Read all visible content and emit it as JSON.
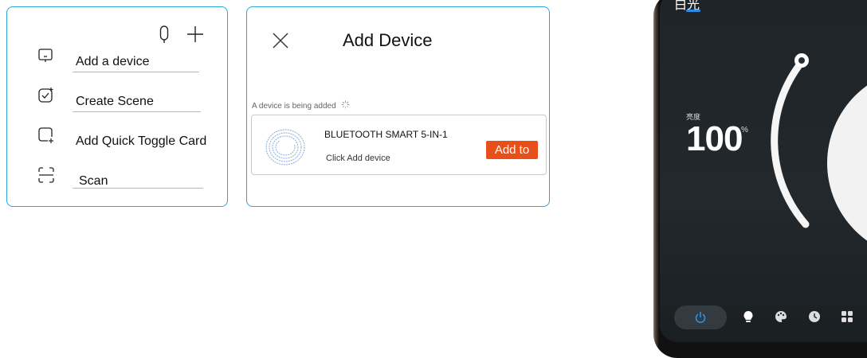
{
  "menu": {
    "items": [
      {
        "label": "Add a device",
        "icon": "add-device-icon"
      },
      {
        "label": "Create Scene",
        "icon": "create-scene-icon"
      },
      {
        "label": "Add Quick Toggle Card",
        "icon": "quick-toggle-card-icon"
      },
      {
        "label": "Scan",
        "icon": "scan-icon"
      }
    ],
    "tools": [
      "microphone-icon",
      "plus-icon"
    ]
  },
  "dialog": {
    "title": "Add Device",
    "status": "A device is being added",
    "device": {
      "name": "BLUETOOTH SMART 5-IN-1",
      "hint": "Click Add device",
      "action": "Add to"
    }
  },
  "phone": {
    "title": "白光",
    "brightness_label": "亮度",
    "brightness_value": "100",
    "brightness_unit": "%",
    "brightness_level": 1.0,
    "nav": [
      "power-icon",
      "bulb-icon",
      "palette-icon",
      "clock-icon",
      "grid-icon"
    ]
  },
  "colors": {
    "accent_border": "#2aa8d8",
    "action_button": "#e8501a",
    "phone_accent": "#2b8de6"
  }
}
